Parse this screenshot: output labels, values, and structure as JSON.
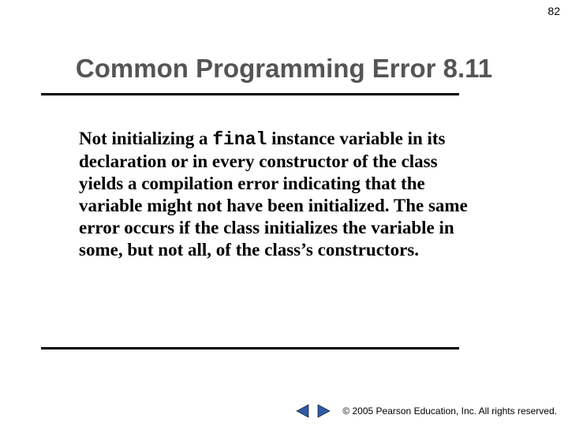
{
  "page_number": "82",
  "heading": "Common Programming Error 8.11",
  "body": {
    "t1": "Not initializing a ",
    "code1": "final",
    "t2": " instance variable in its declaration or in every constructor of the class yields a compilation error indicating that the variable might not have been initialized. The same error occurs if the class initializes the variable in some, but not all, of the class’s constructors."
  },
  "footer": {
    "copyright": "© 2005 Pearson Education, Inc. All rights reserved."
  },
  "icons": {
    "prev": "previous-slide",
    "next": "next-slide"
  }
}
